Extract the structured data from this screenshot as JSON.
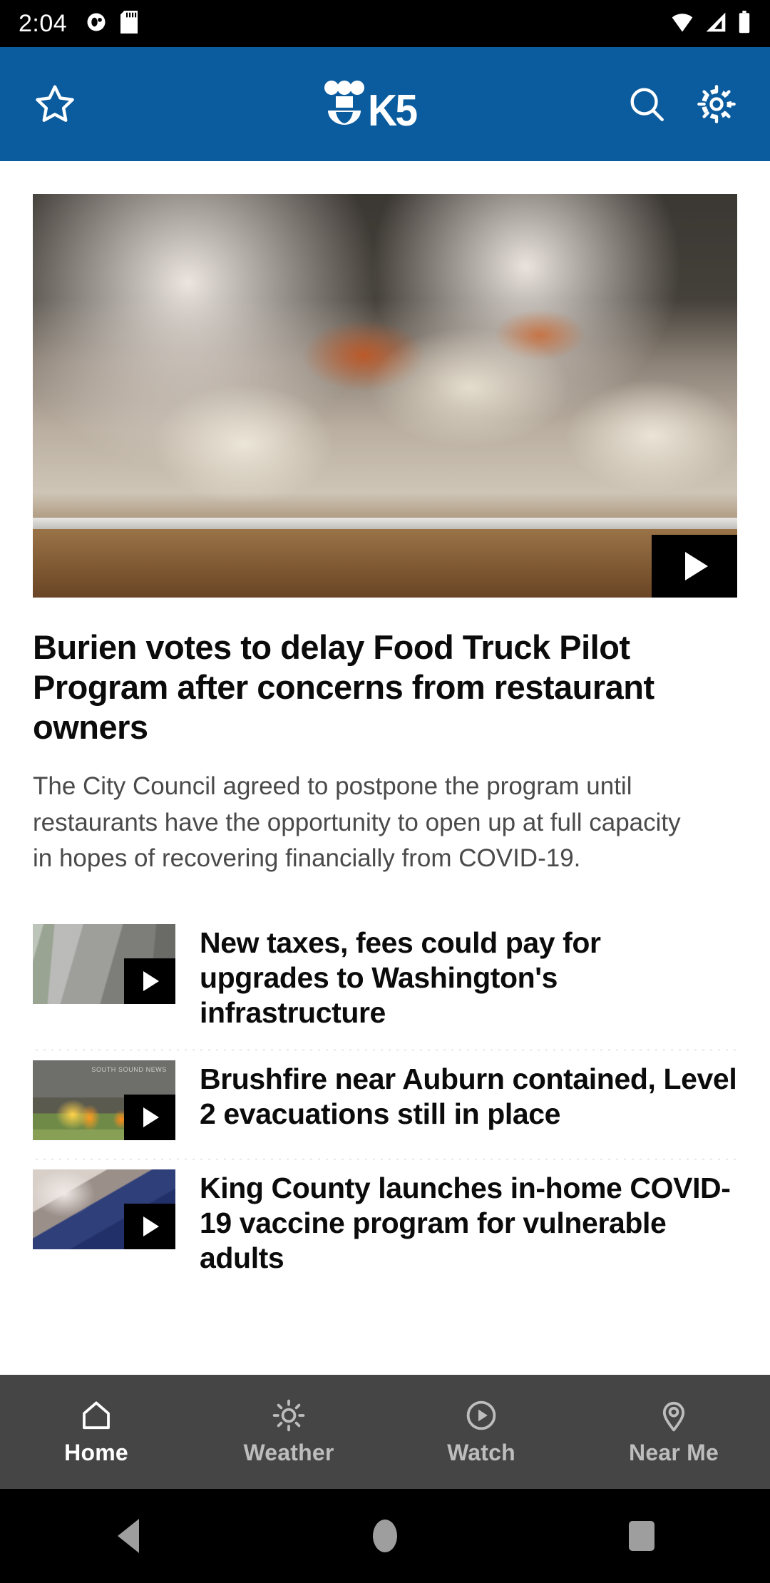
{
  "status_bar": {
    "time": "2:04",
    "left_icons": [
      "app-notification-icon",
      "sd-card-icon"
    ],
    "right_icons": [
      "wifi-icon",
      "cellular-signal-icon",
      "battery-icon"
    ]
  },
  "header": {
    "brand": "K5",
    "favorites_icon": "star-icon",
    "search_icon": "search-icon",
    "settings_icon": "gear-icon",
    "background_color": "#0B5C9E"
  },
  "hero": {
    "title": "Burien votes to delay Food Truck Pilot Program after concerns from restaurant owners",
    "summary": "The City Council agreed to postpone the program until restaurants have the opportunity to open up at full capacity in hopes of recovering financially from COVID-19.",
    "media_type": "video",
    "play_icon": "play-icon"
  },
  "articles": [
    {
      "title": "New taxes, fees could pay for upgrades to Washington's infrastructure",
      "thumb": "highway-traffic-thumbnail",
      "has_video": true,
      "play_icon": "play-icon"
    },
    {
      "title": "Brushfire near Auburn contained, Level 2 evacuations still in place",
      "thumb": "brushfire-thumbnail",
      "thumb_watermark": "SOUTH SOUND NEWS",
      "has_video": true,
      "play_icon": "play-icon"
    },
    {
      "title": "King County launches in-home COVID-19 vaccine program for vulnerable adults",
      "thumb": "vaccine-thumbnail",
      "has_video": true,
      "play_icon": "play-icon"
    }
  ],
  "bottom_nav": {
    "active": "Home",
    "items": [
      {
        "label": "Home",
        "icon": "home-icon"
      },
      {
        "label": "Weather",
        "icon": "sun-icon"
      },
      {
        "label": "Watch",
        "icon": "play-circle-icon"
      },
      {
        "label": "Near Me",
        "icon": "location-pin-icon"
      }
    ]
  },
  "android_nav": {
    "back": "back-button",
    "home": "home-button",
    "recents": "recents-button"
  }
}
